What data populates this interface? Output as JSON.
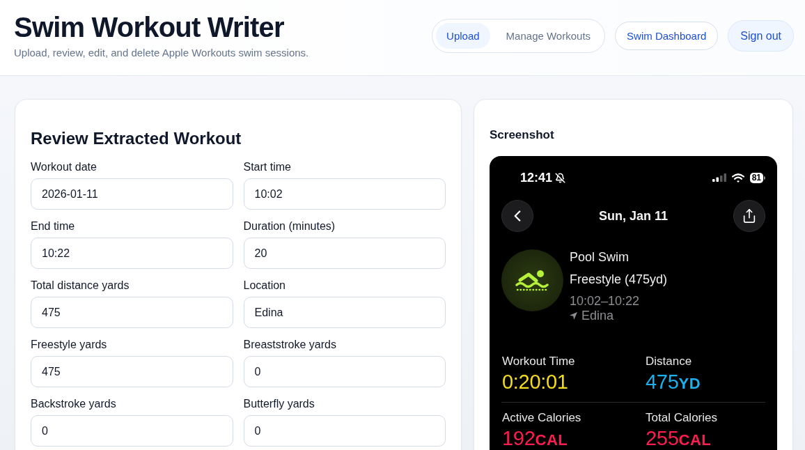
{
  "header": {
    "title": "Swim Workout Writer",
    "subtitle": "Upload, review, edit, and delete Apple Workouts swim sessions."
  },
  "nav": {
    "tabs": [
      {
        "label": "Upload",
        "selected": true
      },
      {
        "label": "Manage Workouts",
        "selected": false
      }
    ],
    "buttons": [
      {
        "label": "Swim Dashboard",
        "kind": "outline"
      },
      {
        "label": "Sign out",
        "kind": "soft"
      }
    ]
  },
  "review_form": {
    "title": "Review Extracted Workout",
    "fields": [
      {
        "label": "Workout date",
        "value": "2026-01-11"
      },
      {
        "label": "Start time",
        "value": "10:02"
      },
      {
        "label": "End time",
        "value": "10:22"
      },
      {
        "label": "Duration (minutes)",
        "value": "20"
      },
      {
        "label": "Total distance yards",
        "value": "475"
      },
      {
        "label": "Location",
        "value": "Edina"
      },
      {
        "label": "Freestyle yards",
        "value": "475"
      },
      {
        "label": "Breaststroke yards",
        "value": "0"
      },
      {
        "label": "Backstroke yards",
        "value": "0"
      },
      {
        "label": "Butterfly yards",
        "value": "0"
      }
    ]
  },
  "screenshot_panel": {
    "title": "Screenshot",
    "phone_screen": {
      "status_bar": {
        "time": "12:41",
        "battery": "81"
      },
      "title": "Sun, Jan 11",
      "workout": {
        "name": "Pool Swim",
        "detail": "Freestyle (475yd)",
        "time_range": "10:02–10:22",
        "location": "Edina"
      },
      "metrics": [
        {
          "label": "Workout Time",
          "value": "0:20:01",
          "color": "#f2dc1c"
        },
        {
          "label": "Distance",
          "value": "475",
          "unit": "YD",
          "color": "#1bb0ee"
        },
        {
          "label": "Active Calories",
          "value": "192",
          "unit": "CAL",
          "color": "#fa1d4e"
        },
        {
          "label": "Total Calories",
          "value": "255",
          "unit": "CAL",
          "color": "#fa1d4e"
        }
      ]
    }
  }
}
